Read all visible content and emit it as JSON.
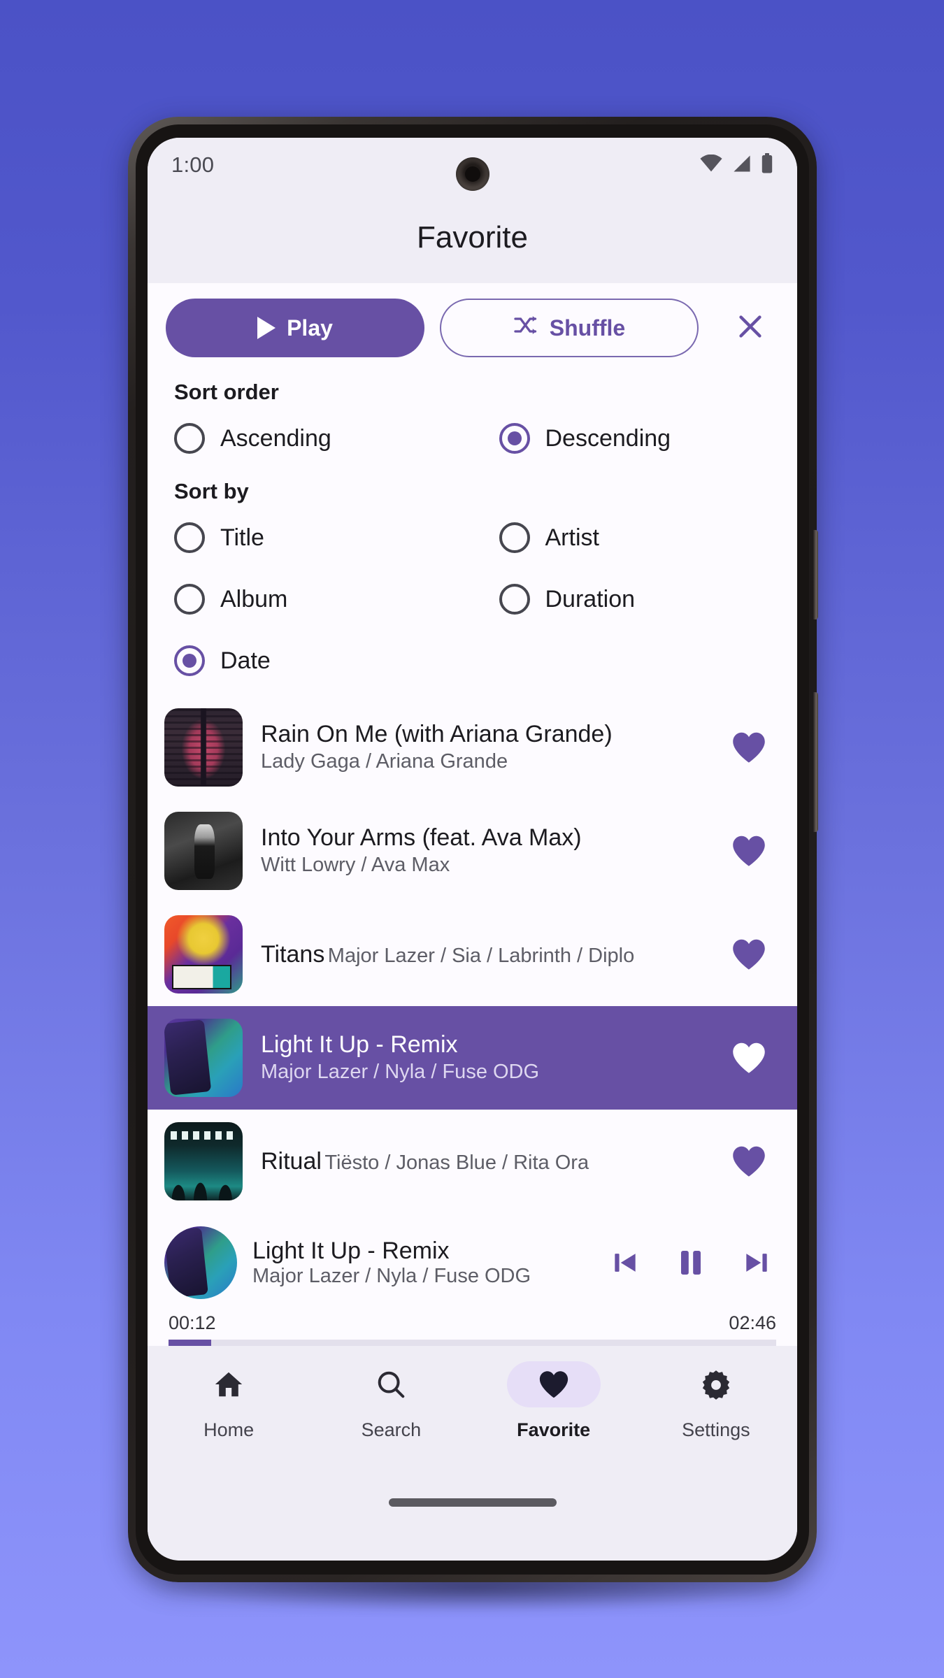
{
  "wallpaper": {
    "top_color": "#4b52c6",
    "bottom_color": "#8e94fb"
  },
  "theme": {
    "primary": "#6750a4",
    "surface": "#fdfbff",
    "surface_variant": "#efedf5",
    "on_surface": "#1c1b20",
    "active_pill": "#e6def7"
  },
  "status_bar": {
    "time": "1:00",
    "icons": [
      "wifi-icon",
      "cellular-signal-icon",
      "battery-icon"
    ]
  },
  "app_bar": {
    "title": "Favorite"
  },
  "actions": {
    "play_label": "Play",
    "play_icon": "play-icon",
    "shuffle_label": "Shuffle",
    "shuffle_icon": "shuffle-icon",
    "close_icon": "close-icon"
  },
  "sort_order": {
    "label": "Sort order",
    "options": [
      {
        "label": "Ascending",
        "selected": false
      },
      {
        "label": "Descending",
        "selected": true
      }
    ]
  },
  "sort_by": {
    "label": "Sort by",
    "options": [
      {
        "label": "Title",
        "selected": false
      },
      {
        "label": "Artist",
        "selected": false
      },
      {
        "label": "Album",
        "selected": false
      },
      {
        "label": "Duration",
        "selected": false
      },
      {
        "label": "Date",
        "selected": true
      }
    ]
  },
  "songs": [
    {
      "title": "Rain On Me (with Ariana Grande)",
      "artist": "Lady Gaga / Ariana Grande",
      "favorite": true,
      "active": false,
      "art": "art-rain"
    },
    {
      "title": "Into Your Arms (feat. Ava Max)",
      "artist": "Witt Lowry / Ava Max",
      "favorite": true,
      "active": false,
      "art": "art-into"
    },
    {
      "title": "Titans",
      "artist": "Major Lazer / Sia / Labrinth / Diplo",
      "favorite": true,
      "active": false,
      "art": "art-titans"
    },
    {
      "title": "Light It Up - Remix",
      "artist": "Major Lazer / Nyla / Fuse ODG",
      "favorite": true,
      "active": true,
      "art": "art-light"
    },
    {
      "title": "Ritual",
      "artist": "Tiësto / Jonas Blue / Rita Ora",
      "favorite": true,
      "active": false,
      "art": "art-ritual"
    }
  ],
  "mini_player": {
    "title": "Light It Up - Remix",
    "artist": "Major Lazer / Nyla / Fuse ODG",
    "art": "art-light",
    "previous_icon": "skip-previous-icon",
    "playpause_icon": "pause-icon",
    "next_icon": "skip-next-icon",
    "elapsed": "00:12",
    "total": "02:46",
    "progress_percent": 7
  },
  "bottom_nav": {
    "items": [
      {
        "label": "Home",
        "icon": "home-icon",
        "active": false
      },
      {
        "label": "Search",
        "icon": "search-icon",
        "active": false
      },
      {
        "label": "Favorite",
        "icon": "heart-icon",
        "active": true
      },
      {
        "label": "Settings",
        "icon": "gear-icon",
        "active": false
      }
    ]
  }
}
